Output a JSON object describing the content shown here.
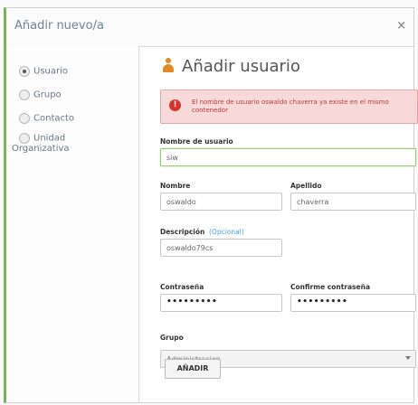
{
  "dialog": {
    "title": "Añadir nuevo/a",
    "close_label": "×"
  },
  "sidebar": {
    "options": [
      {
        "label": "Usuario",
        "checked": true
      },
      {
        "label": "Grupo",
        "checked": false
      },
      {
        "label": "Contacto",
        "checked": false
      },
      {
        "label": "Unidad",
        "label2": "Organizativa",
        "checked": false
      }
    ]
  },
  "form": {
    "heading": "Añadir usuario",
    "heading_icon": "user-icon",
    "alert": {
      "icon": "!",
      "message": "El nombre de usuario oswaldo chaverra ya existe en el mismo contenedor",
      "color": "#d9342b"
    },
    "username": {
      "label": "Nombre de usuario",
      "value": "siw"
    },
    "first_name": {
      "label": "Nombre",
      "value": "oswaldo"
    },
    "last_name": {
      "label": "Apellido",
      "value": "chaverra"
    },
    "description": {
      "label": "Descripción",
      "optional": "(Opcional)",
      "value": "oswaldo79cs"
    },
    "password": {
      "label": "Contraseña",
      "value": "•••••••••"
    },
    "confirm_password": {
      "label": "Confirme contraseña",
      "value": "•••••••••"
    },
    "group": {
      "label": "Grupo",
      "selected": "Administracion"
    },
    "submit_label": "AÑADIR"
  },
  "colors": {
    "accent": "#7fb357",
    "heading_icon": "#e28a21",
    "error_bg": "#f7d9da",
    "optional": "#4aa3d8"
  }
}
